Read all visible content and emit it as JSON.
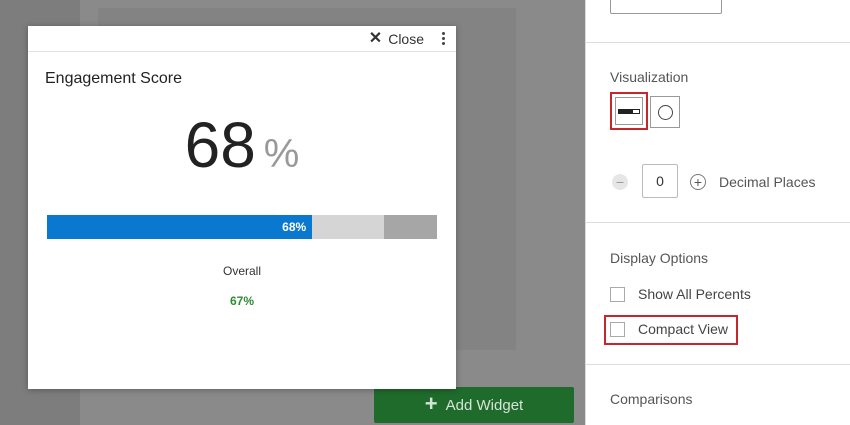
{
  "add_widget": {
    "label": "Add Widget",
    "icon": "plus-icon"
  },
  "modal": {
    "close_label": "Close",
    "widget_title": "Engagement Score",
    "score": "68",
    "unit": "%",
    "bar": {
      "percent": 68,
      "label": "68%"
    },
    "overall_label": "Overall",
    "overall_value": "67%"
  },
  "panel": {
    "visualization_label": "Visualization",
    "visualization_options": [
      "bar",
      "gauge"
    ],
    "decimal_places_value": "0",
    "decimal_places_label": "Decimal Places",
    "display_options_label": "Display Options",
    "show_all_percents_label": "Show All Percents",
    "compact_view_label": "Compact View",
    "comparisons_label": "Comparisons"
  },
  "colors": {
    "bar_fill": "#0b78d0",
    "overall_green": "#2e8b33",
    "highlight_red": "#c8262d",
    "add_widget_green": "#1f6b2c"
  }
}
